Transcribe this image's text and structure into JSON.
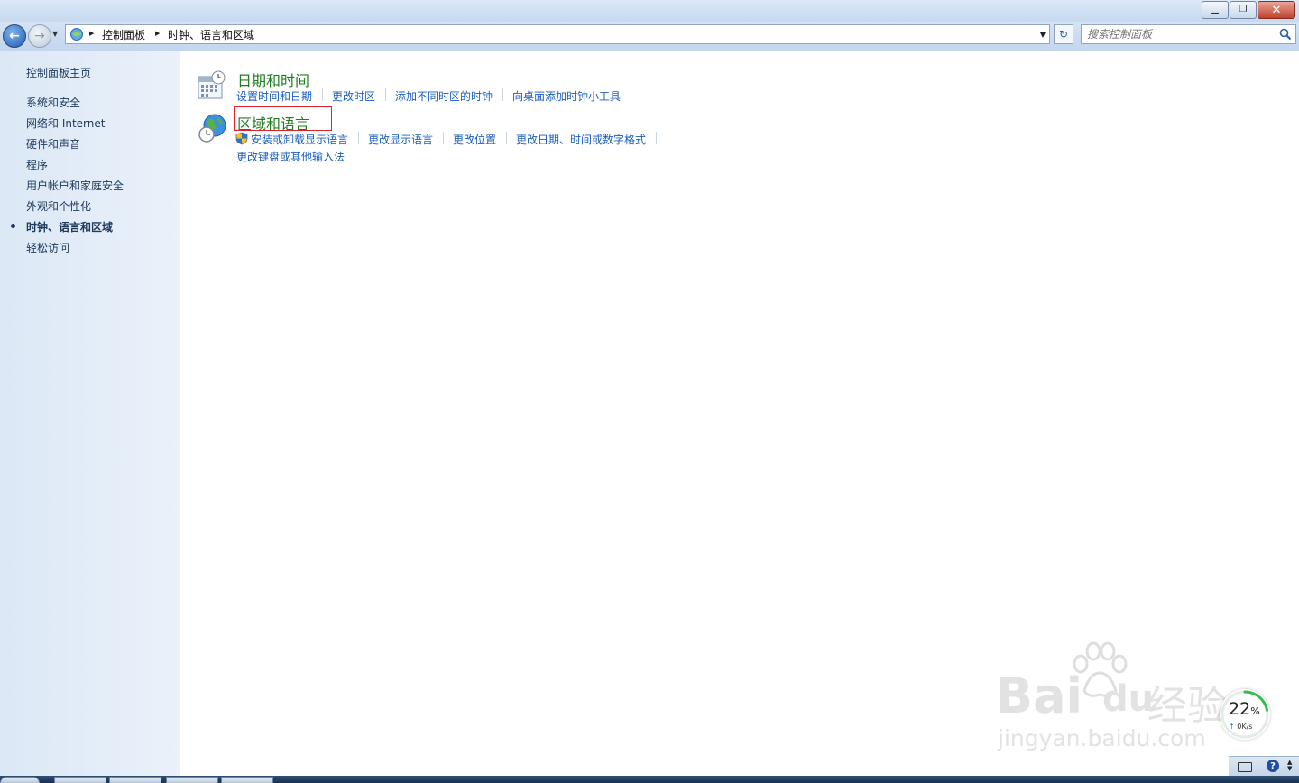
{
  "window": {
    "minimize_glyph": "▁",
    "maximize_glyph": "❐",
    "close_glyph": "✕"
  },
  "nav": {
    "back_glyph": "←",
    "forward_glyph": "→",
    "history_glyph": "▼",
    "breadcrumb": [
      "控制面板",
      "时钟、语言和区域"
    ],
    "breadcrumb_separator": "▶",
    "address_dropdown_glyph": "▼",
    "refresh_glyph": "↻",
    "search_placeholder": "搜索控制面板"
  },
  "sidebar": {
    "home": "控制面板主页",
    "items": [
      {
        "label": "系统和安全",
        "current": false
      },
      {
        "label": "网络和 Internet",
        "current": false
      },
      {
        "label": "硬件和声音",
        "current": false
      },
      {
        "label": "程序",
        "current": false
      },
      {
        "label": "用户帐户和家庭安全",
        "current": false
      },
      {
        "label": "外观和个性化",
        "current": false
      },
      {
        "label": "时钟、语言和区域",
        "current": true
      },
      {
        "label": "轻松访问",
        "current": false
      }
    ]
  },
  "categories": [
    {
      "title": "日期和时间",
      "icon": "calendar-clock-icon",
      "tasks": [
        "设置时间和日期",
        "更改时区",
        "添加不同时区的时钟",
        "向桌面添加时钟小工具"
      ]
    },
    {
      "title": "区域和语言",
      "icon": "globe-clock-icon",
      "highlighted": true,
      "tasks": [
        "安装或卸载显示语言",
        "更改显示语言",
        "更改位置",
        "更改日期、时间或数字格式",
        "更改键盘或其他输入法"
      ],
      "shield_task_index": 0
    }
  ],
  "watermark": {
    "brand": "Bai",
    "brand_suffix": "du",
    "site_name": "经验",
    "url": "jingyan.baidu.com"
  },
  "speed_widget": {
    "percent": "22",
    "percent_sign": "%",
    "rate": "0K/s",
    "rate_arrow": "↑",
    "level_fraction": 0.22,
    "ring_color": "#2fbf4a"
  },
  "tray": {
    "help_glyph": "?",
    "expand_glyph": "▲\n▼"
  },
  "colors": {
    "category_title": "#1f7d1f",
    "task_link": "#1a5ebd",
    "highlight_border": "#e0222b"
  }
}
